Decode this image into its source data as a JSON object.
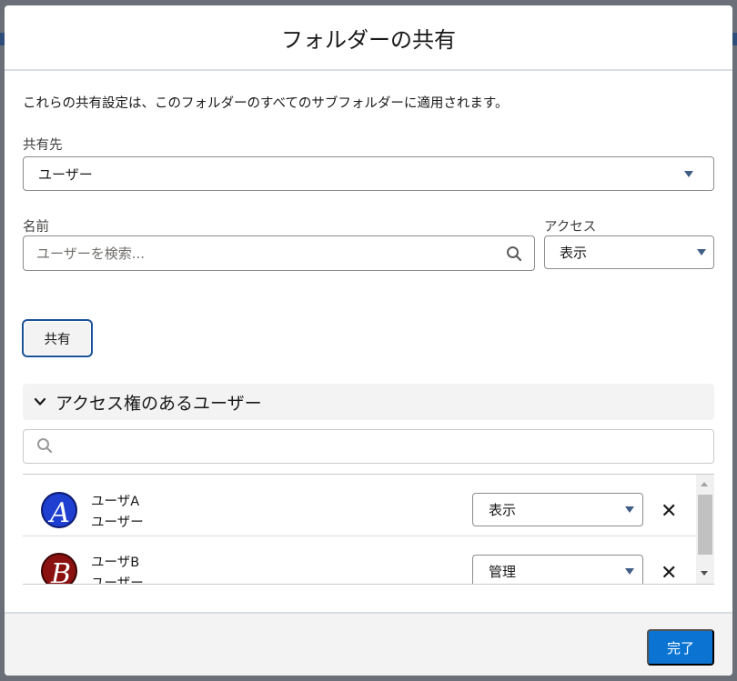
{
  "modal": {
    "title": "フォルダーの共有",
    "description": "これらの共有設定は、このフォルダーのすべてのサブフォルダーに適用されます。"
  },
  "form": {
    "share_with_label": "共有先",
    "share_with_value": "ユーザー",
    "name_label": "名前",
    "search_placeholder": "ユーザーを検索...",
    "access_label": "アクセス",
    "access_value": "表示",
    "share_button": "共有"
  },
  "access_section": {
    "title": "アクセス権のあるユーザー",
    "search_placeholder": "",
    "users": [
      {
        "name": "ユーザA",
        "type": "ユーザー",
        "access": "表示",
        "avatar_letter": "A",
        "avatar_color": "#1e3fd0"
      },
      {
        "name": "ユーザB",
        "type": "ユーザー",
        "access": "管理",
        "avatar_letter": "B",
        "avatar_color": "#8b1111"
      }
    ]
  },
  "footer": {
    "done_button": "完了"
  },
  "colors": {
    "primary": "#0b74d2",
    "focus_border": "#1b5297",
    "dropdown_arrow": "#3f5d86"
  }
}
